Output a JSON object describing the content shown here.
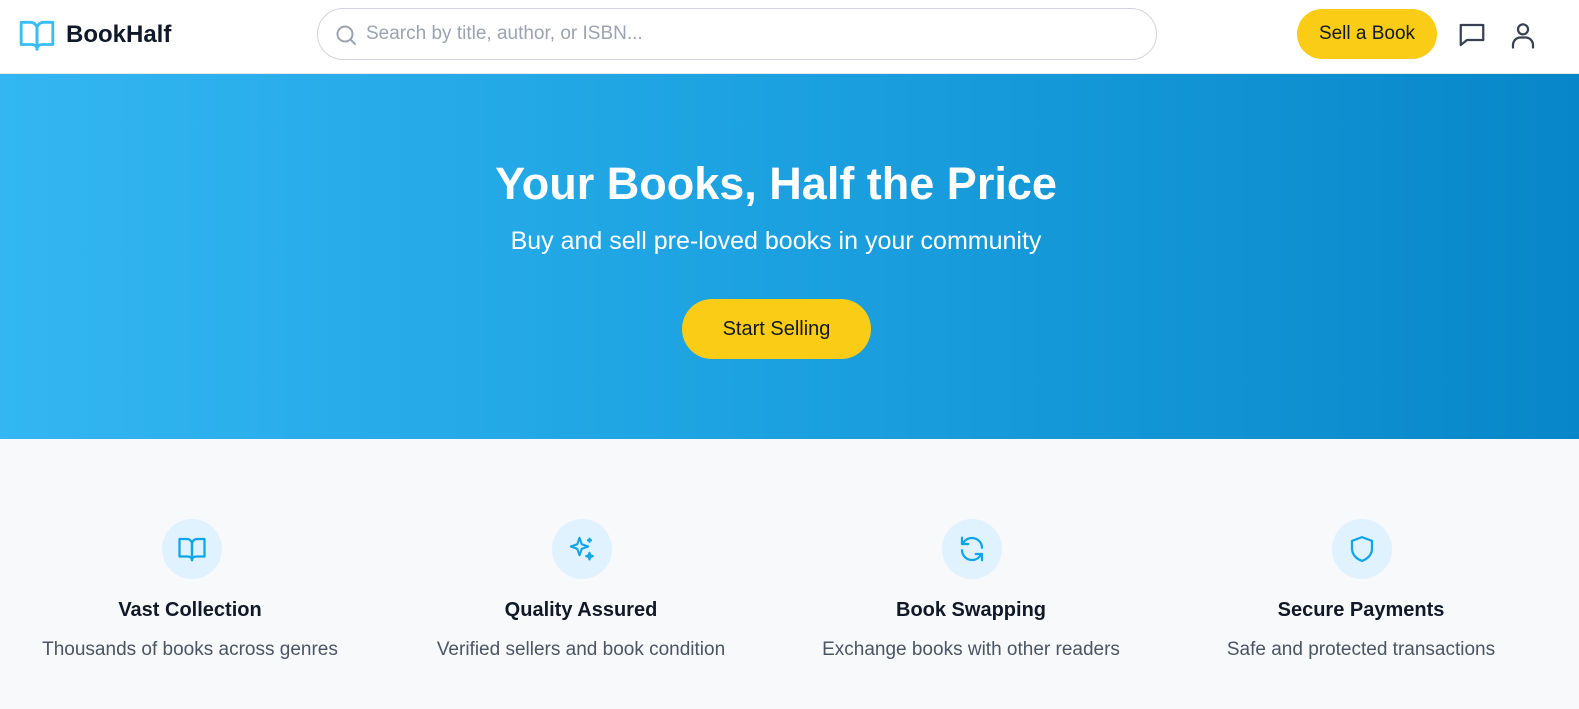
{
  "header": {
    "brand": "BookHalf",
    "search_placeholder": "Search by title, author, or ISBN...",
    "search_value": "",
    "sell_label": "Sell a Book",
    "icons": {
      "logo": "open-book-icon",
      "search": "search-icon",
      "messages": "message-square-icon",
      "account": "user-icon"
    }
  },
  "hero": {
    "title": "Your Books, Half the Price",
    "subtitle": "Buy and sell pre-loved books in your community",
    "cta_label": "Start Selling",
    "colors": {
      "gradient_start": "#33b6f1",
      "gradient_end": "#0787c9",
      "cta": "#facc15"
    }
  },
  "features": [
    {
      "title": "Vast Collection",
      "description": "Thousands of books across genres",
      "icon": "book-open-icon"
    },
    {
      "title": "Quality Assured",
      "description": "Verified sellers and book condition",
      "icon": "sparkles-icon"
    },
    {
      "title": "Book Swapping",
      "description": "Exchange books with other readers",
      "icon": "refresh-icon"
    },
    {
      "title": "Secure Payments",
      "description": "Safe and protected transactions",
      "icon": "shield-icon"
    }
  ],
  "colors": {
    "accent": "#1ea3e2",
    "icon_bg": "#e0f2fe",
    "button": "#facc15"
  }
}
